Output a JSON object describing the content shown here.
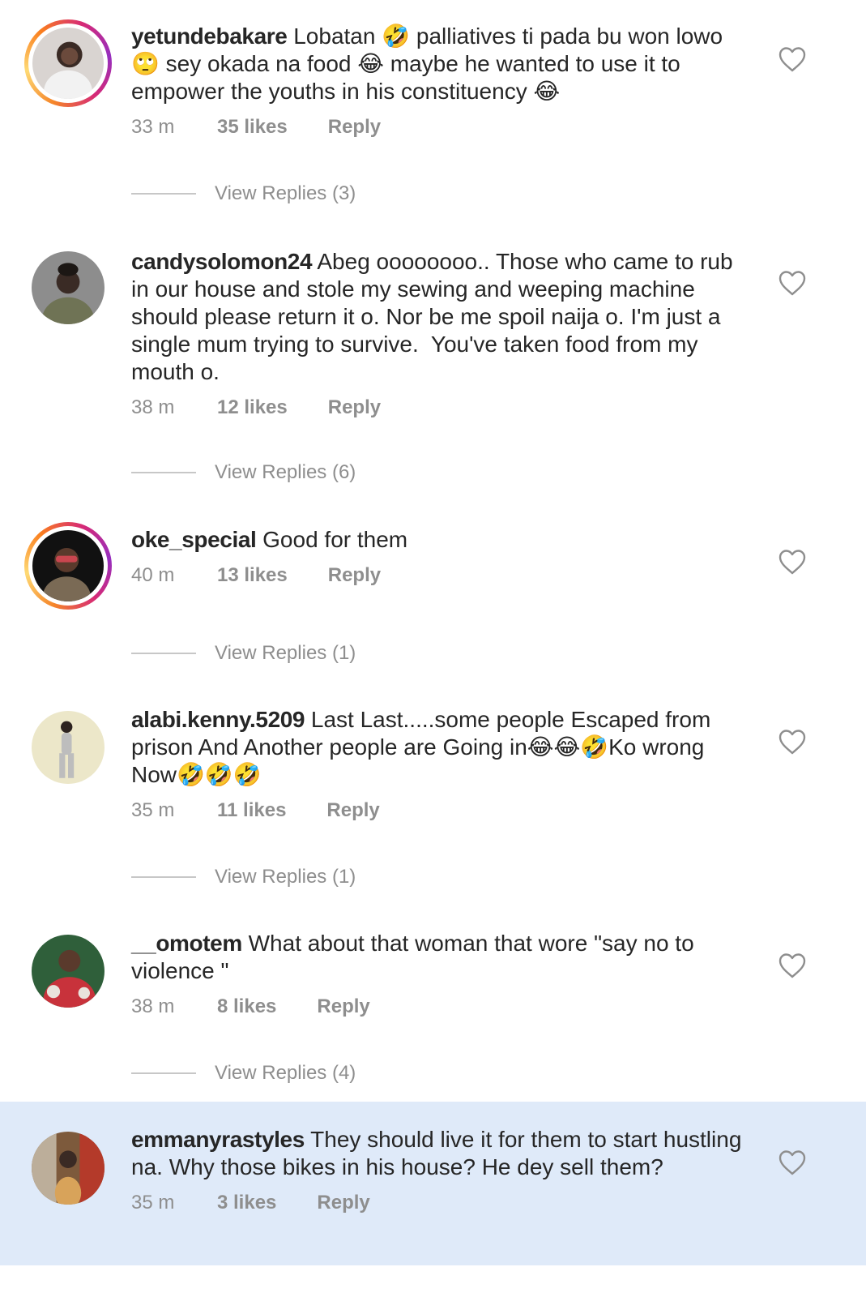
{
  "comments": [
    {
      "username": "yetundebakare",
      "text": " Lobatan 🤣 palliatives ti pada bu won lowo 🙄 sey okada na food 😂 maybe he wanted to use it to empower the youths in his constituency 😂",
      "time": "33 m",
      "likes": "35 likes",
      "reply": "Reply",
      "view_replies": "View Replies (3)",
      "story_ring": true
    },
    {
      "username": "candysolomon24",
      "text": " Abeg oooooooo.. Those who came to rub in our house and stole my sewing and weeping machine should please return it o. Nor be me spoil naija o. I'm just a single mum trying to survive.  You've taken food from my mouth o.",
      "time": "38 m",
      "likes": "12 likes",
      "reply": "Reply",
      "view_replies": "View Replies (6)",
      "story_ring": false
    },
    {
      "username": "oke_special",
      "text": " Good for them",
      "time": "40 m",
      "likes": "13 likes",
      "reply": "Reply",
      "view_replies": "View Replies (1)",
      "story_ring": true
    },
    {
      "username": "alabi.kenny.5209",
      "text": " Last Last.....some people Escaped from prison And Another people are Going in😂😂🤣Ko wrong Now🤣🤣🤣",
      "time": "35 m",
      "likes": "11 likes",
      "reply": "Reply",
      "view_replies": "View Replies (1)",
      "story_ring": false
    },
    {
      "username": "__omotem",
      "text": " What about that woman that wore \"say no to violence \"",
      "time": "38 m",
      "likes": "8 likes",
      "reply": "Reply",
      "view_replies": "View Replies (4)",
      "story_ring": false
    },
    {
      "username": "emmanyrastyles",
      "text": " They should live it for them to start hustling na. Why those bikes in his house? He dey sell them?",
      "time": "35 m",
      "likes": "3 likes",
      "reply": "Reply",
      "highlighted": true,
      "story_ring": false
    }
  ],
  "icons": {
    "like": "heart-outline-icon",
    "avatar": "profile-photo"
  },
  "colors": {
    "text": "#262626",
    "muted": "#8e8e8e",
    "highlight": "#dfeaf9",
    "story_ring_start": "#f58529",
    "story_ring_end": "#962fbf"
  }
}
